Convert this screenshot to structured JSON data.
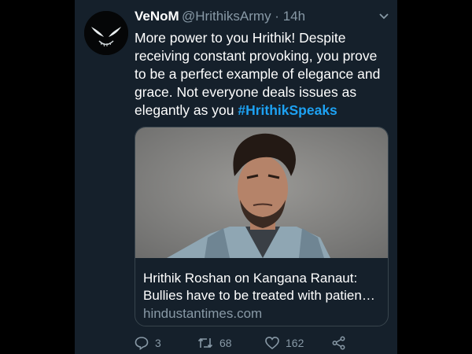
{
  "tweet": {
    "author_name": "VeNoM",
    "handle_time": "@HrithiksArmy · 14h",
    "text_lines": [
      "More power to you Hrithik! Despite",
      "receiving constant provoking, you prove",
      "to be a perfect example of elegance and",
      "grace. Not everyone deals issues as"
    ],
    "text_last_prefix": "elegantly as you ",
    "hashtag": "#HrithikSpeaks"
  },
  "card": {
    "title_lines": [
      "Hrithik Roshan on Kangana Ranaut:",
      "Bullies have to be treated with patien…"
    ],
    "domain": "hindustantimes.com"
  },
  "actions": {
    "reply_count": "3",
    "retweet_count": "68",
    "like_count": "162"
  },
  "icons": {
    "reply": "reply-icon",
    "retweet": "retweet-icon",
    "like": "heart-icon",
    "share": "share-icon",
    "menu": "chevron-down-icon"
  },
  "colors": {
    "background": "#15202b",
    "text": "#ffffff",
    "secondary": "#8899a6",
    "accent": "#1da1f2",
    "border": "#38444d"
  }
}
